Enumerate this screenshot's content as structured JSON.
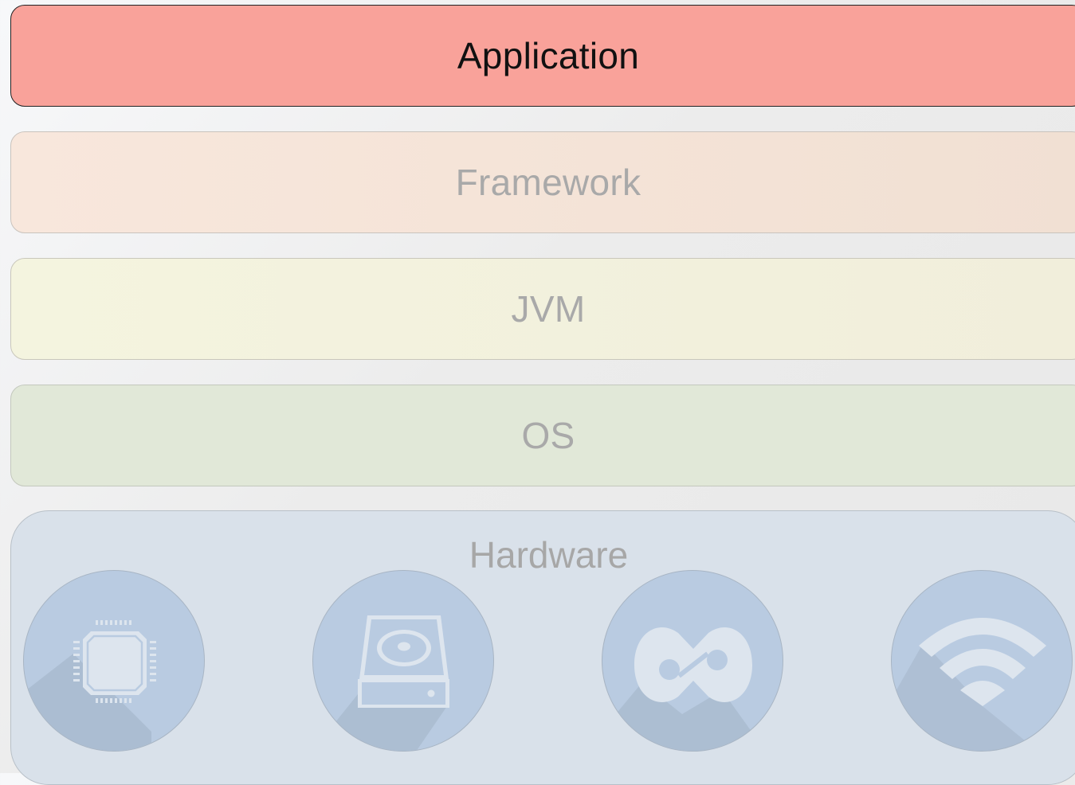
{
  "layers": {
    "application": "Application",
    "framework": "Framework",
    "jvm": "JVM",
    "os": "OS",
    "hardware": "Hardware"
  },
  "hardware_icons": [
    "cpu-icon",
    "hard-drive-icon",
    "infinity-icon",
    "wifi-icon"
  ],
  "colors": {
    "application": "#f9a29a",
    "framework": "#f5e4d8",
    "jvm": "#f3f1de",
    "os": "#e1e8d8",
    "hardware": "#d9e1ea",
    "icon_circle": "#b9cbe1",
    "icon_glyph": "#dde5ee"
  }
}
